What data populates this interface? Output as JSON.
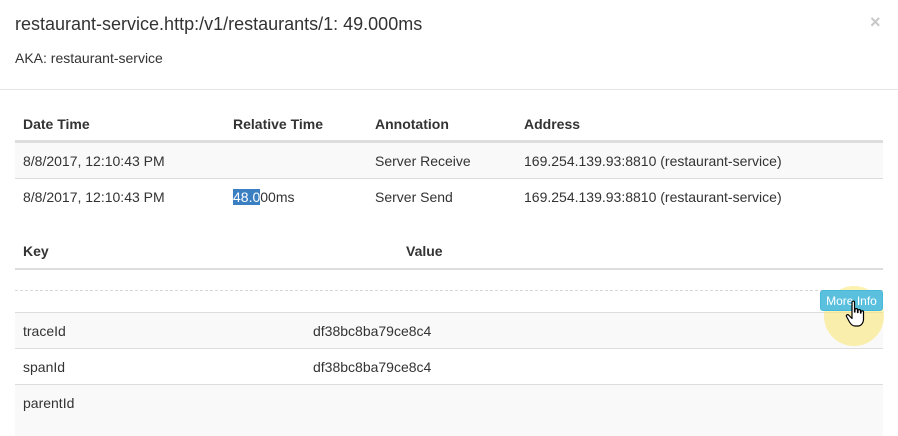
{
  "modal": {
    "title": "restaurant-service.http:/v1/restaurants/1: 49.000ms",
    "aka": "AKA: restaurant-service",
    "close_label": "×"
  },
  "annotations": {
    "headers": [
      "Date Time",
      "Relative Time",
      "Annotation",
      "Address"
    ],
    "rows": [
      {
        "datetime": "8/8/2017, 12:10:43 PM",
        "relative": "",
        "annotation": "Server Receive",
        "address": "169.254.139.93:8810 (restaurant-service)"
      },
      {
        "datetime": "8/8/2017, 12:10:43 PM",
        "relative_selected": "48.0",
        "relative_rest": "00ms",
        "annotation": "Server Send",
        "address": "169.254.139.93:8810 (restaurant-service)"
      }
    ]
  },
  "tags": {
    "headers": [
      "Key",
      "Value"
    ],
    "more_info_label": "More Info",
    "rows": [
      {
        "key": "traceId",
        "value": "df38bc8ba79ce8c4"
      },
      {
        "key": "spanId",
        "value": "df38bc8ba79ce8c4"
      },
      {
        "key": "parentId",
        "value": ""
      }
    ]
  },
  "colors": {
    "info_button": "#5bc0de",
    "selection": "#3a7fc1"
  },
  "icons": {
    "close": "close-icon",
    "cursor": "hand-pointer-icon"
  }
}
